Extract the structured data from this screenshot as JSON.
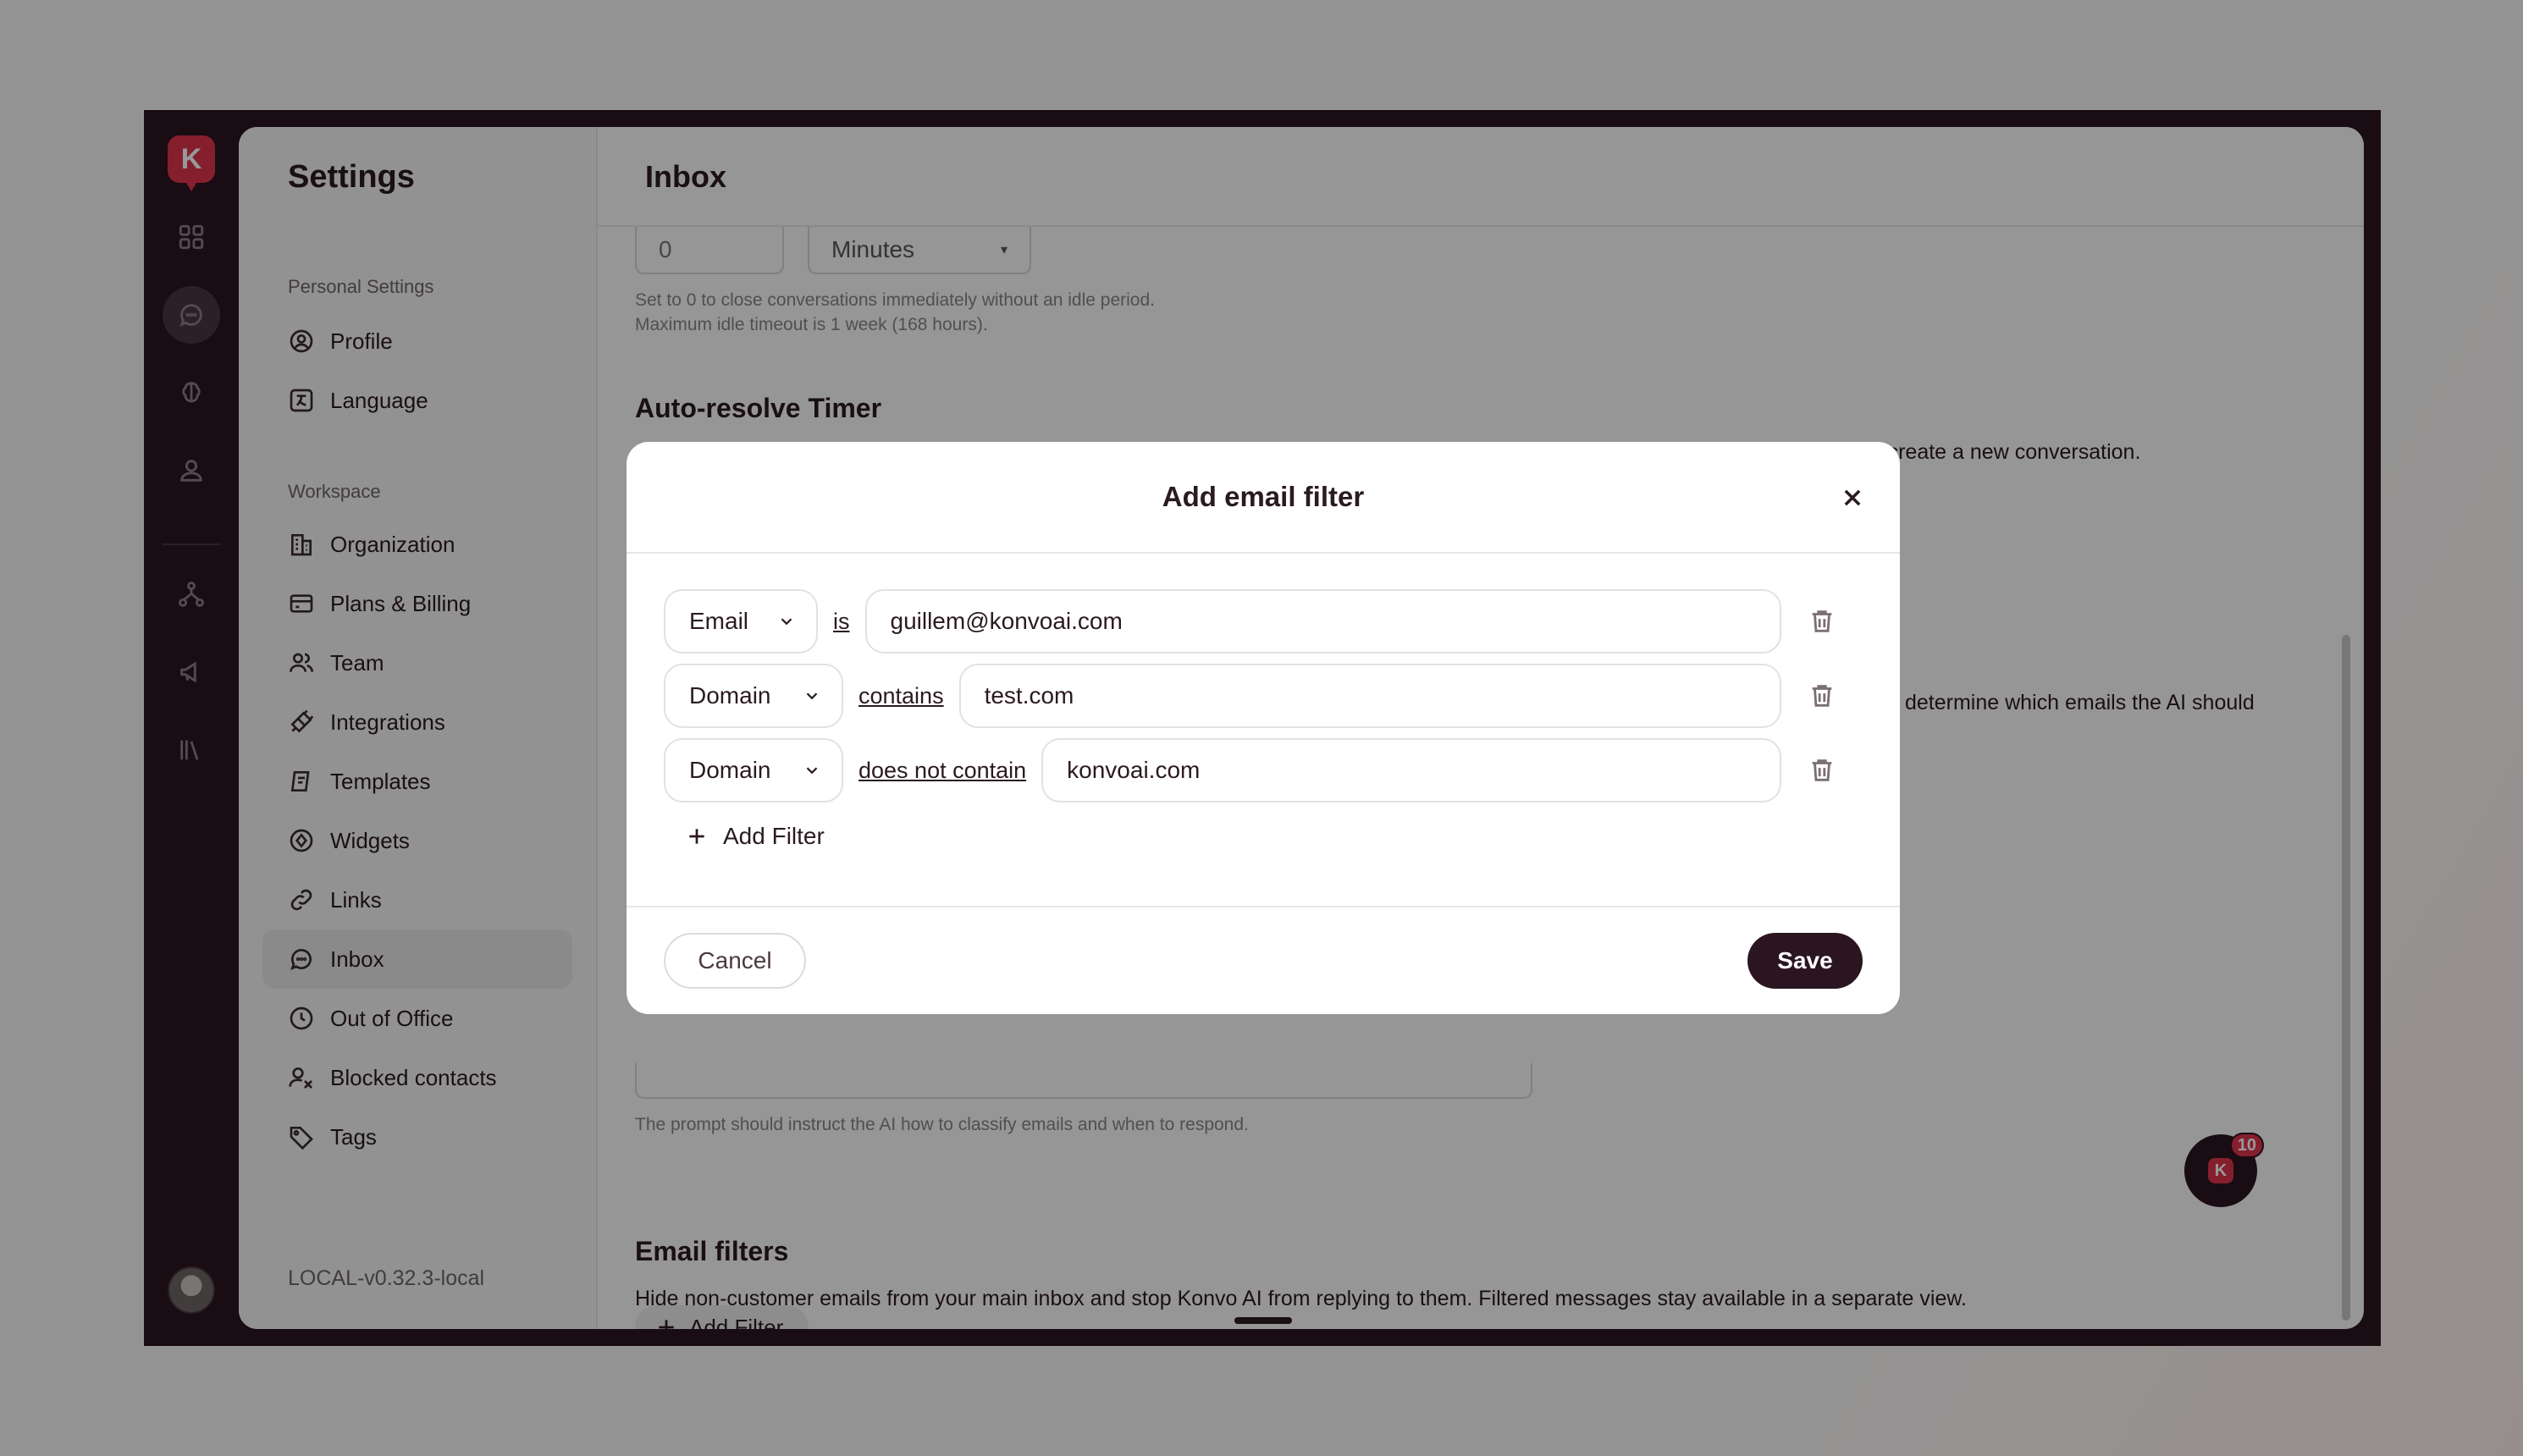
{
  "rail": {
    "items": [
      {
        "name": "dashboard-icon"
      },
      {
        "name": "chat-icon",
        "active": true
      },
      {
        "name": "brain-icon"
      },
      {
        "name": "contact-icon"
      },
      {
        "name": "workflow-icon"
      },
      {
        "name": "megaphone-icon"
      },
      {
        "name": "library-icon"
      }
    ]
  },
  "sidebar": {
    "title": "Settings",
    "personal_label": "Personal Settings",
    "personal_items": [
      {
        "label": "Profile",
        "icon": "user-circle-icon"
      },
      {
        "label": "Language",
        "icon": "language-icon"
      }
    ],
    "workspace_label": "Workspace",
    "workspace_items": [
      {
        "label": "Organization",
        "icon": "building-icon"
      },
      {
        "label": "Plans & Billing",
        "icon": "credit-card-icon"
      },
      {
        "label": "Team",
        "icon": "team-icon"
      },
      {
        "label": "Integrations",
        "icon": "plug-icon"
      },
      {
        "label": "Templates",
        "icon": "templates-icon"
      },
      {
        "label": "Widgets",
        "icon": "widget-icon"
      },
      {
        "label": "Links",
        "icon": "link-icon"
      },
      {
        "label": "Inbox",
        "icon": "inbox-chat-icon",
        "active": true
      },
      {
        "label": "Out of Office",
        "icon": "clock-icon"
      },
      {
        "label": "Blocked contacts",
        "icon": "blocked-user-icon"
      },
      {
        "label": "Tags",
        "icon": "tag-icon"
      }
    ],
    "version": "LOCAL-v0.32.3-local"
  },
  "main": {
    "title": "Inbox",
    "idle_value": "0",
    "idle_unit": "Minutes",
    "idle_hint_1": "Set to 0 to close conversations immediately without an idle period.",
    "idle_hint_2": "Maximum idle timeout is 1 week (168 hours).",
    "auto_resolve_title": "Auto-resolve Timer",
    "auto_resolve_partial": "ill create a new conversation.",
    "classify_partial": "determine which emails the AI should",
    "prompt_hint": "The prompt should instruct the AI how to classify emails and when to respond.",
    "email_filters_title": "Email filters",
    "email_filters_desc": "Hide non-customer emails from your main inbox and stop Konvo AI from replying to them. Filtered messages stay available in a separate view.",
    "add_filter_label": "Add Filter"
  },
  "chat_widget": {
    "badge": "10",
    "logo_letter": "K"
  },
  "modal": {
    "title": "Add email filter",
    "filters": [
      {
        "field": "Email",
        "operator": "is",
        "value": "guillem@konvoai.com"
      },
      {
        "field": "Domain",
        "operator": "contains",
        "value": "test.com"
      },
      {
        "field": "Domain",
        "operator": "does not contain",
        "value": "konvoai.com"
      }
    ],
    "add_filter_label": "Add Filter",
    "cancel_label": "Cancel",
    "save_label": "Save"
  },
  "colors": {
    "brand": "#e0344c",
    "dark": "#2a1520",
    "overlay": "rgba(0,0,0,0.4)"
  }
}
